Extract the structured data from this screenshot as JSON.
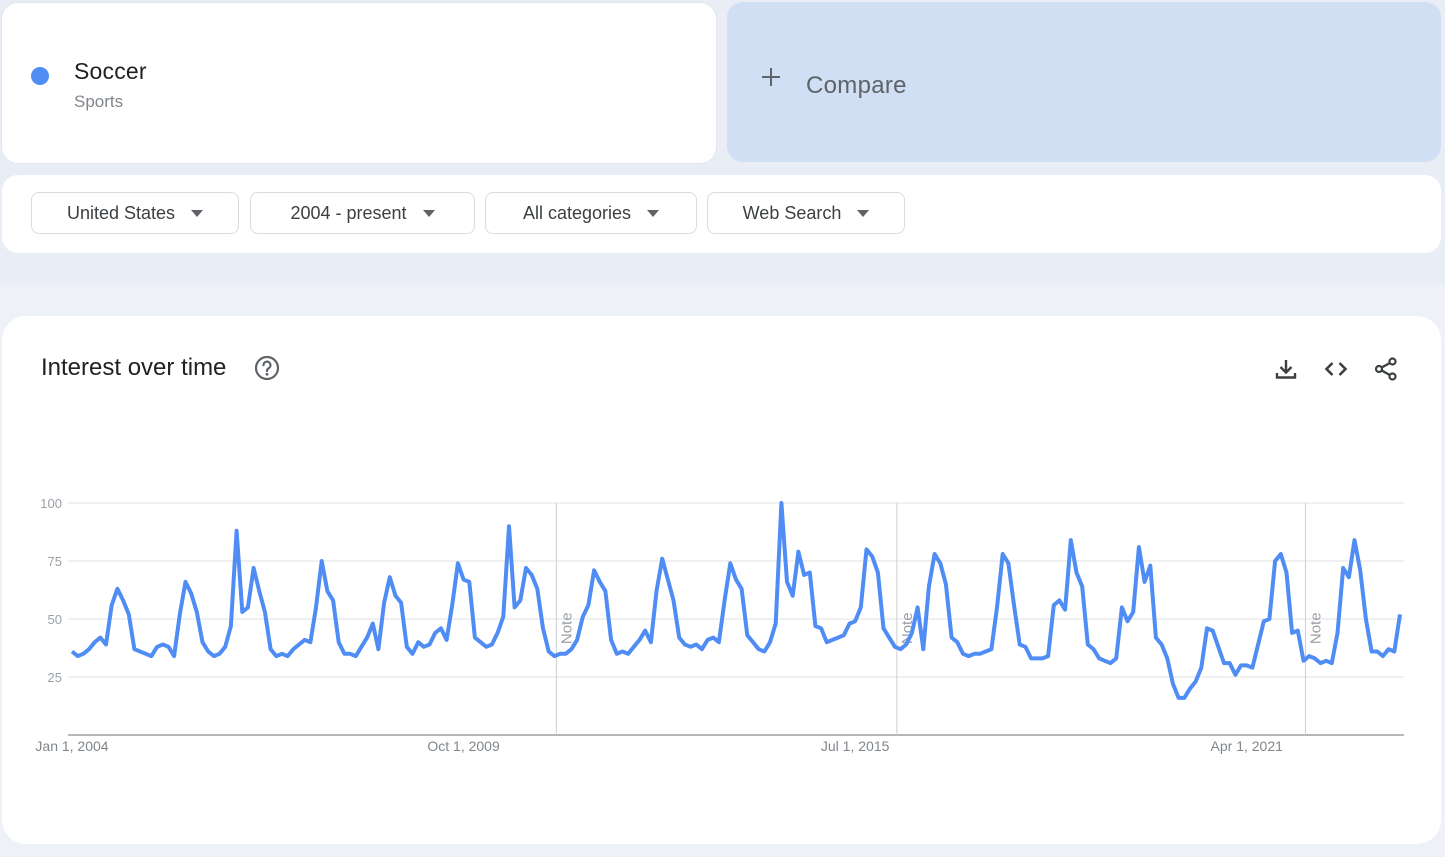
{
  "term": {
    "name": "Soccer",
    "category": "Sports",
    "color": "#4f8df5"
  },
  "compare": {
    "label": "Compare",
    "icon": "plus-icon"
  },
  "filters": [
    {
      "label": "United States",
      "icon": "caret-down-icon"
    },
    {
      "label": "2004 - present",
      "icon": "caret-down-icon"
    },
    {
      "label": "All categories",
      "icon": "caret-down-icon"
    },
    {
      "label": "Web Search",
      "icon": "caret-down-icon"
    }
  ],
  "chart_card": {
    "title": "Interest over time",
    "help_icon": "help-circle-icon",
    "actions": [
      {
        "name": "download",
        "icon": "download-icon"
      },
      {
        "name": "embed",
        "icon": "code-icon"
      },
      {
        "name": "share",
        "icon": "share-icon"
      }
    ]
  },
  "chart_data": {
    "type": "line",
    "title": "Interest over time",
    "xlabel": "",
    "ylabel": "",
    "ylim": [
      0,
      100
    ],
    "yticks": [
      25,
      50,
      75,
      100
    ],
    "grid": true,
    "legend": "none",
    "x_start": "2004-01",
    "x_interval": "month",
    "xtick_labels": [
      {
        "label": "Jan 1, 2004",
        "index": 0
      },
      {
        "label": "Oct 1, 2009",
        "index": 69
      },
      {
        "label": "Jul 1, 2015",
        "index": 138
      },
      {
        "label": "Apr 1, 2021",
        "index": 207
      }
    ],
    "notes": [
      {
        "label": "Note",
        "index": 85
      },
      {
        "label": "Note",
        "index": 145
      },
      {
        "label": "Note",
        "index": 217
      }
    ],
    "series": [
      {
        "name": "Soccer",
        "color": "#4f8df5",
        "values": [
          36,
          34,
          35,
          37,
          40,
          42,
          39,
          56,
          63,
          58,
          52,
          37,
          36,
          35,
          34,
          38,
          39,
          38,
          34,
          52,
          66,
          61,
          53,
          40,
          36,
          34,
          35,
          38,
          47,
          88,
          53,
          55,
          72,
          62,
          53,
          37,
          34,
          35,
          34,
          37,
          39,
          41,
          40,
          55,
          75,
          62,
          58,
          40,
          35,
          35,
          34,
          38,
          42,
          48,
          37,
          57,
          68,
          60,
          57,
          38,
          35,
          40,
          38,
          39,
          44,
          46,
          41,
          56,
          74,
          67,
          66,
          42,
          40,
          38,
          39,
          44,
          51,
          90,
          55,
          58,
          72,
          69,
          63,
          46,
          36,
          34,
          35,
          35,
          37,
          41,
          51,
          56,
          71,
          66,
          62,
          41,
          35,
          36,
          35,
          38,
          41,
          45,
          40,
          62,
          76,
          67,
          58,
          42,
          39,
          38,
          39,
          37,
          41,
          42,
          40,
          58,
          74,
          67,
          63,
          43,
          40,
          37,
          36,
          40,
          48,
          100,
          66,
          60,
          79,
          69,
          70,
          47,
          46,
          40,
          41,
          42,
          43,
          48,
          49,
          55,
          80,
          77,
          70,
          46,
          42,
          38,
          37,
          39,
          44,
          55,
          37,
          64,
          78,
          74,
          65,
          42,
          40,
          35,
          34,
          35,
          35,
          36,
          37,
          55,
          78,
          74,
          56,
          39,
          38,
          33,
          33,
          33,
          34,
          56,
          58,
          54,
          84,
          70,
          64,
          39,
          37,
          33,
          32,
          31,
          33,
          55,
          49,
          53,
          81,
          66,
          73,
          42,
          39,
          33,
          22,
          16,
          16,
          20,
          23,
          29,
          46,
          45,
          38,
          31,
          31,
          26,
          30,
          30,
          29,
          39,
          49,
          50,
          75,
          78,
          70,
          44,
          45,
          32,
          34,
          33,
          31,
          32,
          31,
          44,
          72,
          68,
          84,
          71,
          50,
          36,
          36,
          34,
          37,
          36,
          52
        ]
      }
    ]
  }
}
